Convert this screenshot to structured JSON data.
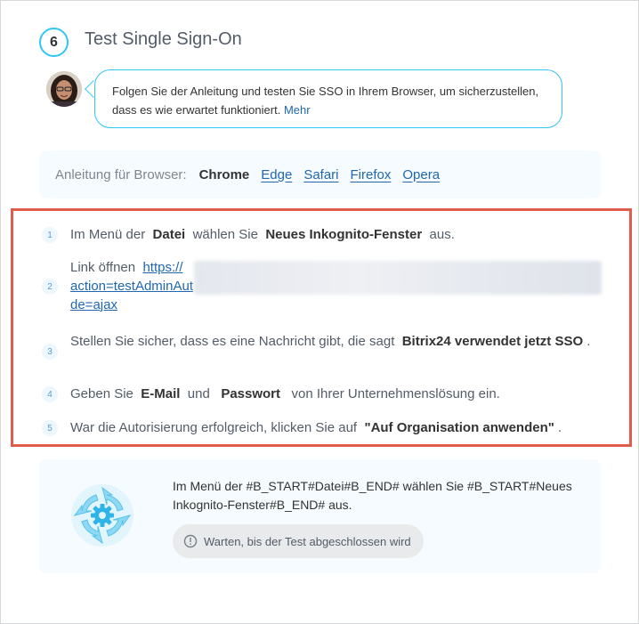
{
  "header": {
    "step_number": "6",
    "title": "Test Single Sign-On"
  },
  "hint": {
    "text": "Folgen Sie der Anleitung und testen Sie SSO in Ihrem Browser, um sicherzustellen, dass es wie erwartet funktioniert.",
    "more_link": "Mehr"
  },
  "browsers": {
    "label": "Anleitung für Browser:",
    "options": [
      "Chrome",
      "Edge",
      "Safari",
      "Firefox",
      "Opera"
    ],
    "active": "Chrome"
  },
  "steps": [
    {
      "num": "1",
      "parts": [
        "Im Menü der",
        "Datei",
        "wählen Sie",
        "Neues Inkognito-Fenster",
        "aus."
      ]
    },
    {
      "num": "2",
      "prefix": "Link öffnen",
      "link_line1": "https://",
      "link_line2": "action=testAdminAut",
      "link_line3": "de=ajax"
    },
    {
      "num": "3",
      "parts": [
        "Stellen Sie sicher, dass es eine Nachricht gibt, die sagt",
        "Bitrix24 verwendet jetzt SSO",
        "."
      ]
    },
    {
      "num": "4",
      "parts": [
        "Geben Sie",
        "E-Mail",
        "und",
        "Passwort",
        "von Ihrer Unternehmenslösung ein."
      ]
    },
    {
      "num": "5",
      "parts": [
        "War die Autorisierung erfolgreich, klicken Sie auf",
        "\"Auf Organisation anwenden\"",
        "."
      ]
    }
  ],
  "progress": {
    "text": "Im Menü der #B_START#Datei#B_END# wählen Sie #B_START#Neues Inkognito-Fenster#B_END# aus.",
    "status": "Warten, bis der Test abgeschlossen wird"
  },
  "colors": {
    "accent": "#2fc6f6",
    "link": "#2067b0",
    "highlight_border": "#e25c4e"
  }
}
